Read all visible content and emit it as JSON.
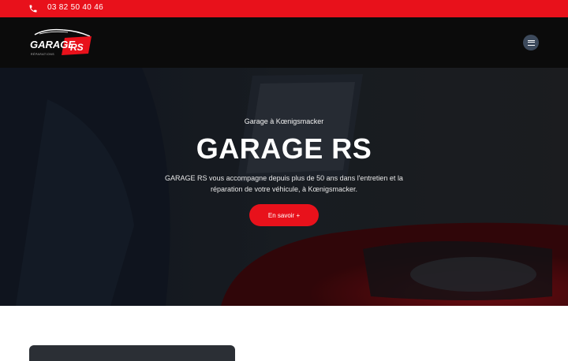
{
  "topbar": {
    "phone_icon": "phone-icon",
    "phone": "03 82 50 40 46",
    "bg_color": "#e8111b"
  },
  "header": {
    "logo": {
      "brand": "GARAGE",
      "accent": "RS",
      "tagline": "RÉPARATIONS"
    },
    "menu_icon": "hamburger-menu-icon"
  },
  "hero": {
    "kicker": "Garage à Kœnigsmacker",
    "title": "GARAGE RS",
    "description": "GARAGE RS vous accompagne depuis plus de 50 ans dans l'entretien et la réparation de votre véhicule, à Kœnigsmacker.",
    "cta_label": "En savoir +"
  },
  "colors": {
    "accent": "#e8111b",
    "header_bg": "#0b0b0b",
    "menu_button": "#3d4a5c"
  }
}
